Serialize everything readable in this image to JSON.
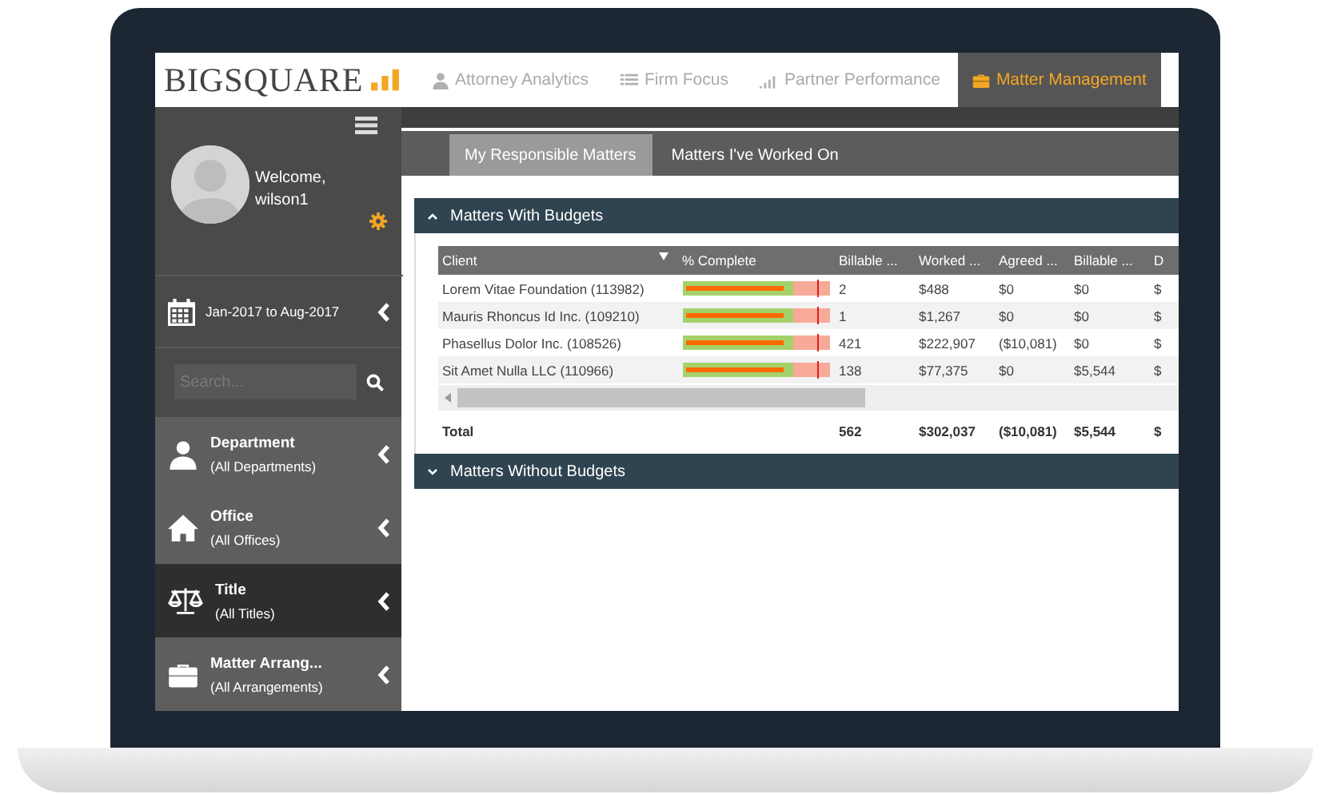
{
  "brand": {
    "name": "BIGSQUARE"
  },
  "nav_tabs": [
    {
      "kind": "person",
      "label": "Attorney Analytics",
      "selected": false
    },
    {
      "kind": "list",
      "label": "Firm Focus",
      "selected": false
    },
    {
      "kind": "bars",
      "label": "Partner Performance",
      "selected": false
    },
    {
      "kind": "briefcase",
      "label": "Matter Management",
      "selected": true
    }
  ],
  "sidebar": {
    "welcome": "Welcome,",
    "user": "wilson1",
    "date_range": "Jan-2017 to Aug-2017",
    "search": {
      "placeholder": "Search..."
    },
    "filters": [
      {
        "kind": "person",
        "title": "Department",
        "value": "(All Departments)",
        "selected": false
      },
      {
        "kind": "house",
        "title": "Office",
        "value": "(All Offices)",
        "selected": false
      },
      {
        "kind": "scales",
        "title": "Title",
        "value": "(All Titles)",
        "selected": true
      },
      {
        "kind": "briefcase",
        "title": "Matter Arrang...",
        "value": "(All Arrangements)",
        "selected": false
      }
    ]
  },
  "subtabs": [
    {
      "label": "My Responsible Matters",
      "selected": true
    },
    {
      "label": "Matters I've Worked On",
      "selected": false
    }
  ],
  "panels": [
    {
      "title": "Matters With Budgets",
      "expanded": true,
      "table": {
        "columns": [
          {
            "label": "Client",
            "sorted": true
          },
          {
            "label": "% Complete",
            "sorted": false
          },
          {
            "label": "Billable ...",
            "sorted": false
          },
          {
            "label": "Worked ...",
            "sorted": false
          },
          {
            "label": "Agreed ...",
            "sorted": false
          },
          {
            "label": "Billable ...",
            "sorted": false
          },
          {
            "label": "D",
            "sorted": false
          }
        ],
        "rows": [
          {
            "client": "Lorem Vitae Foundation (113982)",
            "level": 0.7,
            "values": [
              "2",
              "$488",
              "$0",
              "$0",
              "$"
            ]
          },
          {
            "client": "Mauris Rhoncus Id Inc. (109210)",
            "level": 0.7,
            "values": [
              "1",
              "$1,267",
              "$0",
              "$0",
              "$"
            ]
          },
          {
            "client": "Phasellus Dolor Inc. (108526)",
            "level": 0.7,
            "values": [
              "421",
              "$222,907",
              "($10,081)",
              "$0",
              "$"
            ]
          },
          {
            "client": "Sit Amet Nulla LLC (110966)",
            "level": 0.7,
            "values": [
              "138",
              "$77,375",
              "$0",
              "$5,544",
              "$"
            ]
          }
        ],
        "total": {
          "label": "Total",
          "values": [
            "562",
            "$302,037",
            "($10,081)",
            "$5,544",
            "$"
          ]
        }
      }
    },
    {
      "title": "Matters Without Budgets",
      "expanded": false
    }
  ]
}
